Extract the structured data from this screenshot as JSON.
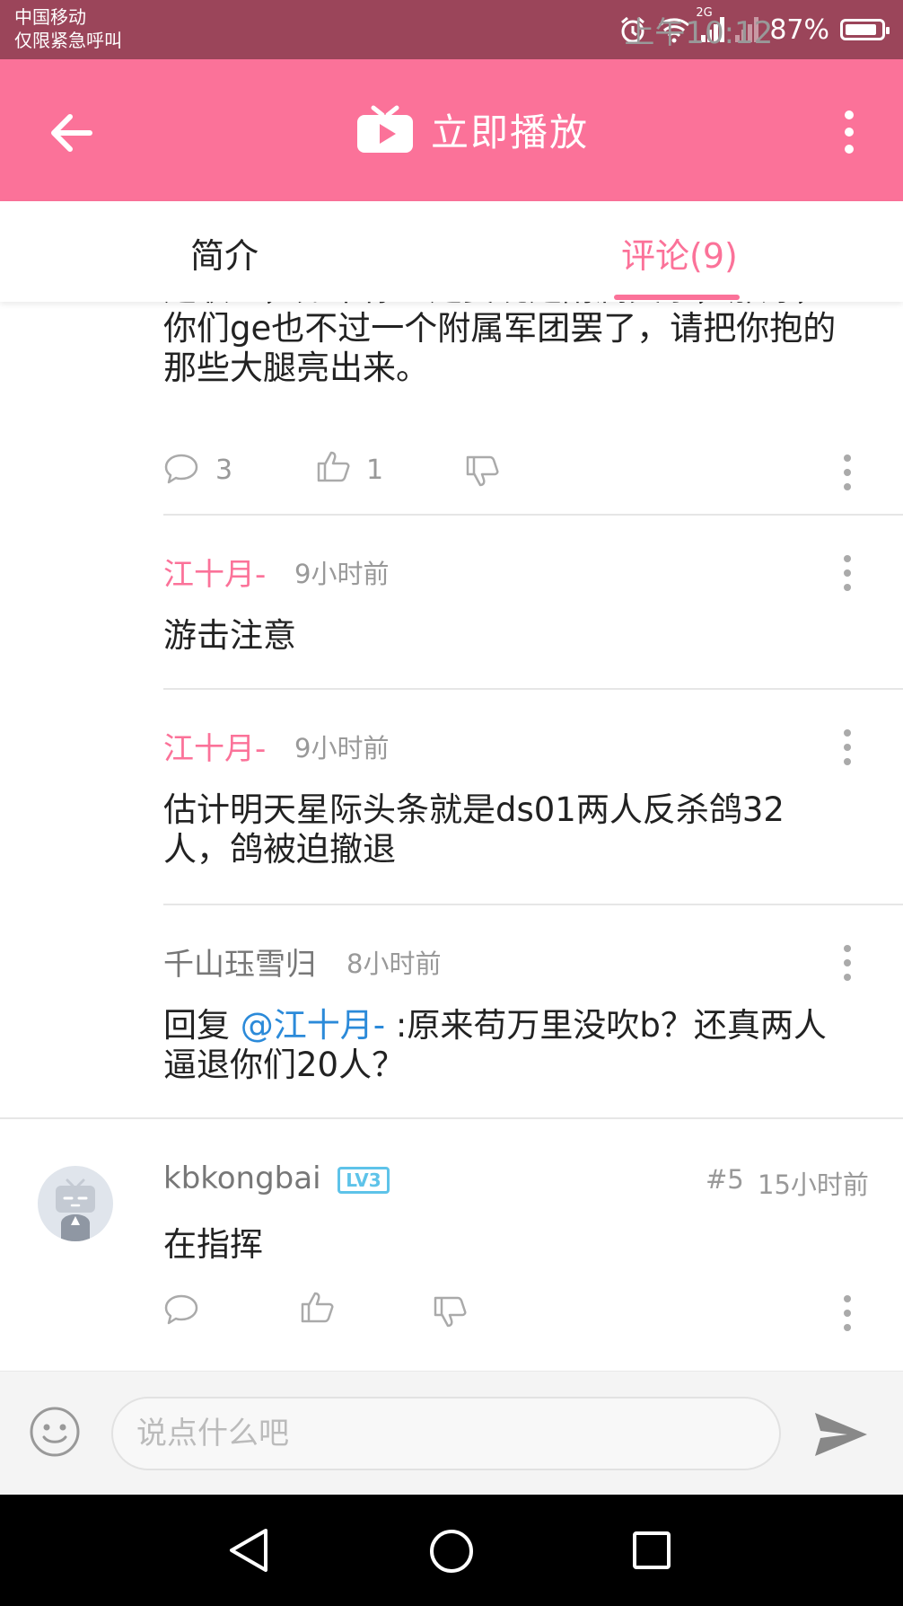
{
  "status_bar": {
    "carrier_line1": "中国移动",
    "carrier_line2": "仅限紧急呼叫",
    "network": "2G",
    "battery": "87%",
    "time": "上午10:12"
  },
  "toolbar": {
    "title": "立即播放",
    "accent": "#fb7299"
  },
  "tabs": [
    {
      "label": "简介"
    },
    {
      "label": "评论(9)",
      "active": true
    }
  ],
  "comments": {
    "c1": {
      "text_lines": [
        "是联盟，如果你一定要说是附属关系，那好，",
        "你们ge也不过一个附属军团罢了，请把你抱的",
        "那些大腿亮出来。"
      ],
      "reply_count": "3",
      "like_count": "1"
    },
    "c2": {
      "author": "江十月-",
      "time": "9小时前",
      "text": "游击注意"
    },
    "c3": {
      "author": "江十月-",
      "time": "9小时前",
      "text_lines": [
        "估计明天星际头条就是ds01两人反杀鸽32",
        "人，鸽被迫撤退"
      ]
    },
    "c4": {
      "author": "千山珏雪归",
      "time": "8小时前",
      "reply_prefix": "回复 ",
      "mention": "@江十月-",
      "text_line1_rest": " :原来苟万里没吹b？还真两人",
      "text_line2": "逼退你们20人？"
    },
    "c5": {
      "author": "kbkongbai",
      "level": "LV3",
      "floor": "#5",
      "time": "15小时前",
      "text": "在指挥"
    }
  },
  "input": {
    "placeholder": "说点什么吧"
  }
}
